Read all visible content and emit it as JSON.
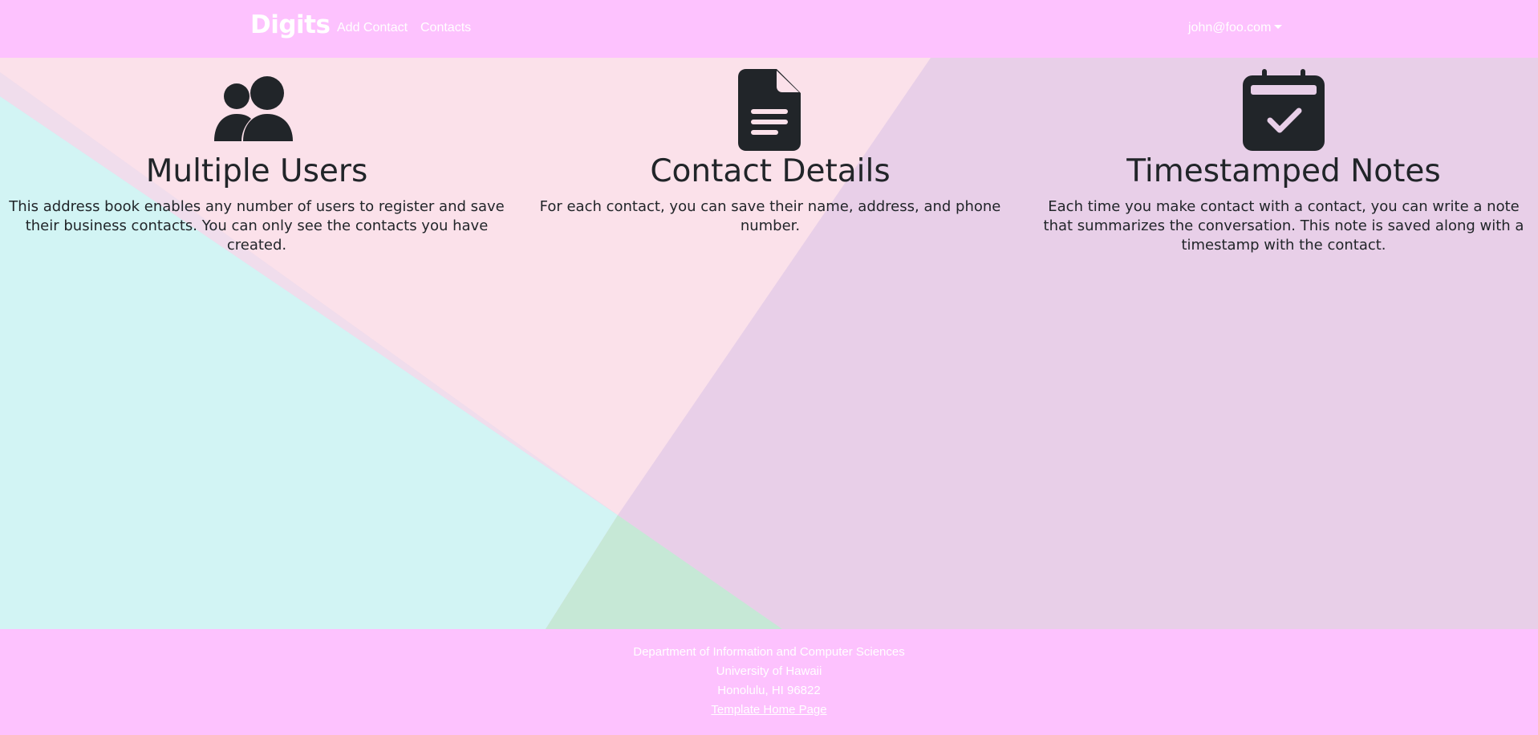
{
  "navbar": {
    "brand": "Digits",
    "links": [
      {
        "label": "Add Contact"
      },
      {
        "label": "Contacts"
      }
    ],
    "user": "john@foo.com"
  },
  "features": [
    {
      "icon": "users-icon",
      "title": "Multiple Users",
      "text": "This address book enables any number of users to register and save their business contacts. You can only see the contacts you have created."
    },
    {
      "icon": "file-text-icon",
      "title": "Contact Details",
      "text": "For each contact, you can save their name, address, and phone number."
    },
    {
      "icon": "calendar-check-icon",
      "title": "Timestamped Notes",
      "text": "Each time you make contact with a contact, you can write a note that summarizes the conversation. This note is saved along with a timestamp with the contact."
    }
  ],
  "footer": {
    "lines": [
      "Department of Information and Computer Sciences",
      "University of Hawaii",
      "Honolulu, HI 96822"
    ],
    "link": "Template Home Page"
  },
  "colors": {
    "navbar_bg": "#fdc2fe",
    "text_dark": "#212529",
    "bg_cyan": "#d2f4f4",
    "bg_pink": "#fbe1ea",
    "bg_lavender": "#e8cfe8",
    "bg_green": "#c6e8d6"
  }
}
